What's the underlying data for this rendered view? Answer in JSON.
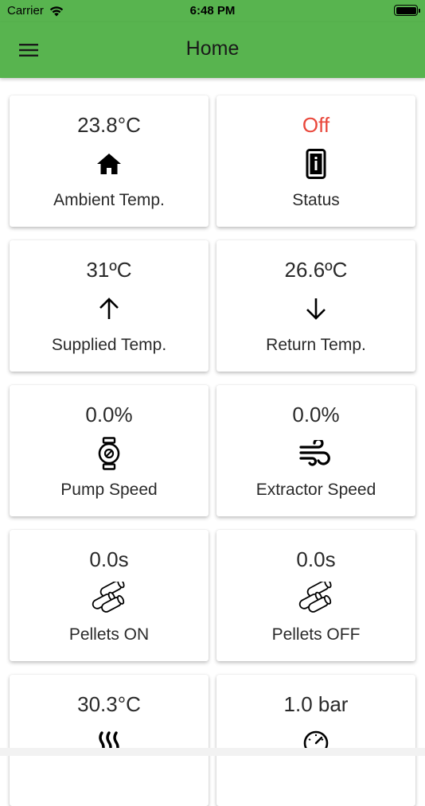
{
  "status_bar": {
    "carrier": "Carrier",
    "time": "6:48 PM"
  },
  "header": {
    "title": "Home"
  },
  "accent_color": "#58b44f",
  "off_color": "#e9473b",
  "cards": [
    {
      "value": "23.8°C",
      "label": "Ambient Temp.",
      "icon": "home-icon"
    },
    {
      "value": "Off",
      "label": "Status",
      "icon": "device-info-icon"
    },
    {
      "value": "31ºC",
      "label": "Supplied Temp.",
      "icon": "arrow-up-icon"
    },
    {
      "value": "26.6ºC",
      "label": "Return Temp.",
      "icon": "arrow-down-icon"
    },
    {
      "value": "0.0%",
      "label": "Pump Speed",
      "icon": "pump-icon"
    },
    {
      "value": "0.0%",
      "label": "Extractor Speed",
      "icon": "wind-icon"
    },
    {
      "value": "0.0s",
      "label": "Pellets ON",
      "icon": "pellets-icon"
    },
    {
      "value": "0.0s",
      "label": "Pellets OFF",
      "icon": "pellets-icon"
    },
    {
      "value": "30.3°C",
      "label": "",
      "icon": "heat-icon"
    },
    {
      "value": "1.0 bar",
      "label": "",
      "icon": "gauge-icon"
    }
  ]
}
